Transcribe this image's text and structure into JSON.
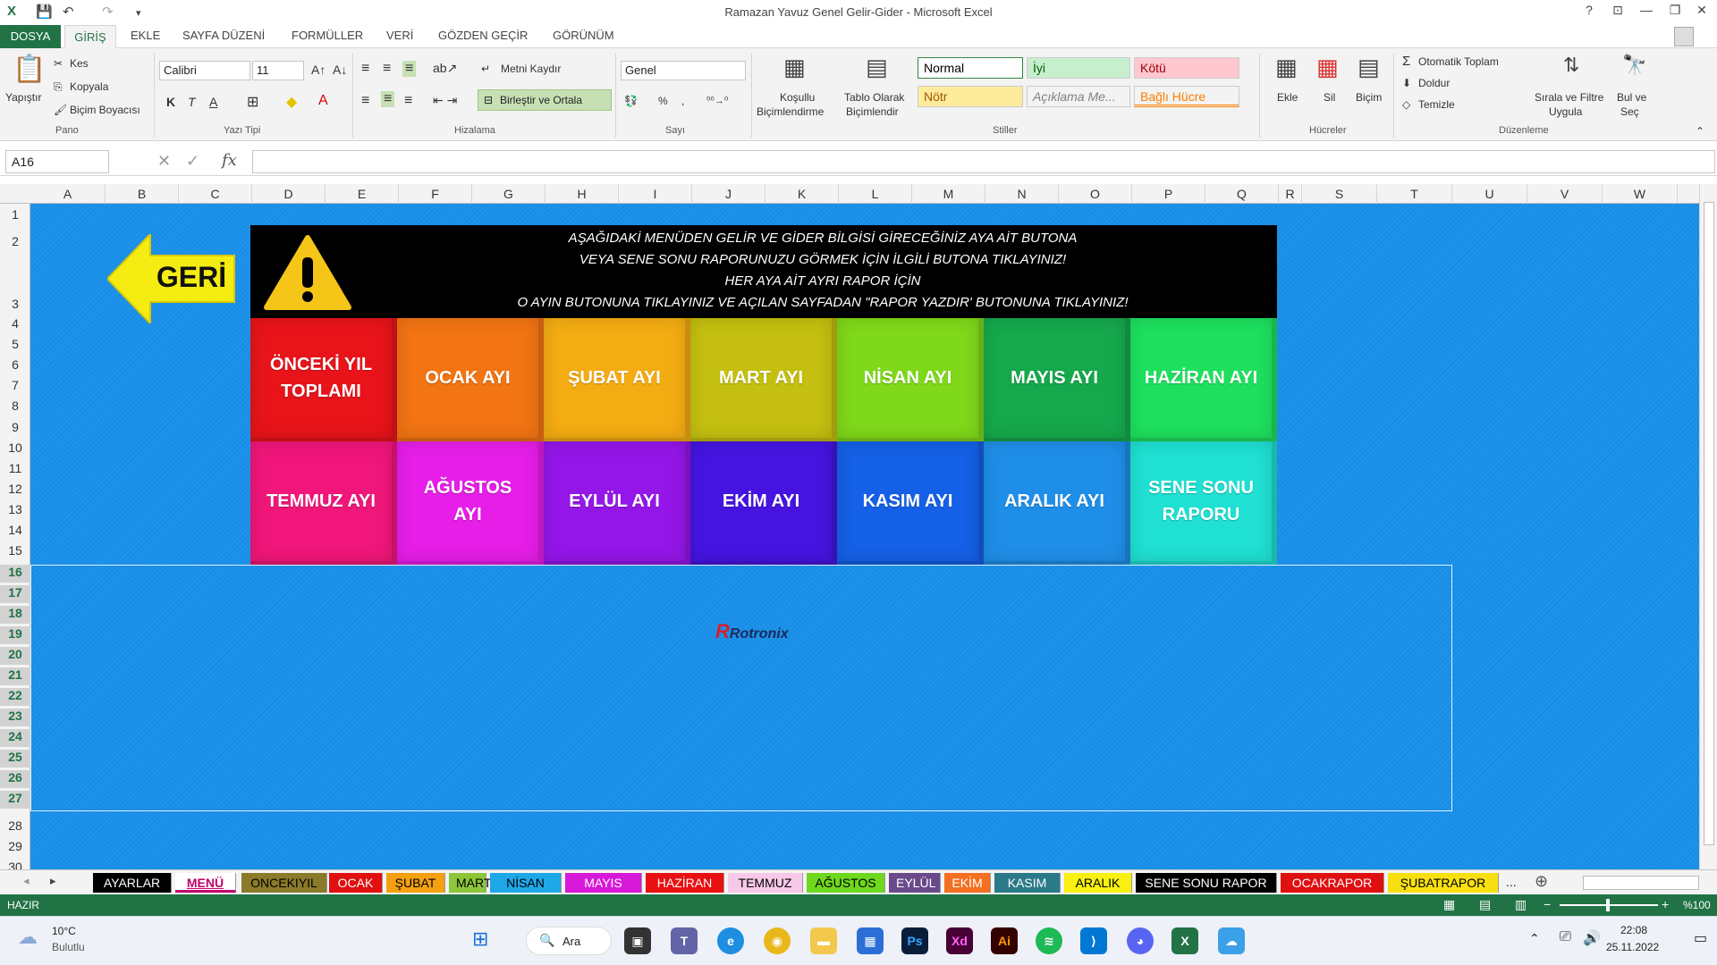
{
  "window": {
    "title": "Ramazan Yavuz Genel Gelir-Gider - Microsoft Excel",
    "help": "?",
    "minimize": "—",
    "restore": "❐",
    "close": "✕"
  },
  "ribbon_tabs": [
    "DOSYA",
    "GİRİŞ",
    "EKLE",
    "SAYFA DÜZENİ",
    "FORMÜLLER",
    "VERİ",
    "GÖZDEN GEÇİR",
    "GÖRÜNÜM"
  ],
  "clipboard": {
    "paste": "Yapıştır",
    "cut": "Kes",
    "copy": "Kopyala",
    "format_painter": "Biçim Boyacısı",
    "group": "Pano"
  },
  "font": {
    "name": "Calibri",
    "size": "11",
    "bold": "K",
    "italic": "T",
    "underline": "A",
    "group": "Yazı Tipi"
  },
  "alignment": {
    "wrap": "Metni Kaydır",
    "merge": "Birleştir ve Ortala",
    "group": "Hizalama"
  },
  "number": {
    "format": "Genel",
    "percent": "%",
    "comma": "⁹",
    "group": "Sayı"
  },
  "styles": {
    "conditional": [
      "Koşullu",
      "Biçimlendirme"
    ],
    "as_table": [
      "Tablo Olarak",
      "Biçimlendir"
    ],
    "cells": [
      {
        "label": "Normal",
        "bg": "#ffffff",
        "fg": "#000000"
      },
      {
        "label": "İyi",
        "bg": "#c6efce",
        "fg": "#006100"
      },
      {
        "label": "Kötü",
        "bg": "#ffc7ce",
        "fg": "#9c0006"
      },
      {
        "label": "Nötr",
        "bg": "#ffeb9c",
        "fg": "#9c5700"
      },
      {
        "label": "Açıklama Me...",
        "bg": "#f3f3f3",
        "fg": "#7f7f7f"
      },
      {
        "label": "Bağlı Hücre",
        "bg": "#f3f3f3",
        "fg": "#fa7d00"
      }
    ],
    "group": "Stiller"
  },
  "cells_group": {
    "insert": "Ekle",
    "delete": "Sil",
    "format": "Biçim",
    "group": "Hücreler"
  },
  "editing": {
    "autosum": "Otomatik Toplam",
    "fill": "Doldur",
    "clear": "Temizle",
    "sort": [
      "Sırala ve Filtre",
      "Uygula"
    ],
    "find": [
      "Bul ve",
      "Seç"
    ],
    "group": "Düzenleme"
  },
  "formula_bar": {
    "name_box": "A16",
    "fx": "fx",
    "value": ""
  },
  "columns": [
    "A",
    "B",
    "C",
    "D",
    "E",
    "F",
    "G",
    "H",
    "I",
    "J",
    "K",
    "L",
    "M",
    "N",
    "O",
    "P",
    "Q",
    "R",
    "S",
    "T",
    "U",
    "V",
    "W"
  ],
  "rows": [
    "1",
    "2",
    "3",
    "4",
    "5",
    "6",
    "7",
    "8",
    "9",
    "10",
    "11",
    "12",
    "13",
    "14",
    "15",
    "16",
    "17",
    "18",
    "19",
    "20",
    "21",
    "22",
    "23",
    "24",
    "25",
    "26",
    "27",
    "28",
    "29",
    "30"
  ],
  "dashboard": {
    "back_label": "GERİ",
    "banner_lines": [
      "AŞAĞIDAKİ MENÜDEN GELİR VE GİDER BİLGİSİ GİRECEĞİNİZ AYA AİT BUTONA",
      "VEYA SENE SONU RAPORUNUZU GÖRMEK İÇİN İLGİLİ BUTONA TIKLAYINIZ!",
      "HER AYA AİT AYRI RAPOR İÇİN",
      "O AYIN BUTONUNA TIKLAYINIZ VE AÇILAN SAYFADAN \"RAPOR YAZDIR' BUTONUNA TIKLAYINIZ!"
    ],
    "buttons": [
      {
        "label": "ÖNCEKİ YIL TOPLAMI",
        "color": "#e8141a"
      },
      {
        "label": "OCAK AYI",
        "color": "#f27413"
      },
      {
        "label": "ŞUBAT AYI",
        "color": "#f4ac13"
      },
      {
        "label": "MART AYI",
        "color": "#c4bf10"
      },
      {
        "label": "NİSAN AYI",
        "color": "#7fd81a"
      },
      {
        "label": "MAYIS AYI",
        "color": "#16a84c"
      },
      {
        "label": "HAZİRAN AYI",
        "color": "#1ee05e"
      },
      {
        "label": "TEMMUZ AYI",
        "color": "#f0167a"
      },
      {
        "label": "AĞUSTOS AYI",
        "color": "#e61ee8"
      },
      {
        "label": "EYLÜL AYI",
        "color": "#9416e8"
      },
      {
        "label": "EKİM AYI",
        "color": "#4514e0"
      },
      {
        "label": "KASIM AYI",
        "color": "#1460e6"
      },
      {
        "label": "ARALIK AYI",
        "color": "#1f8ee8"
      },
      {
        "label": "SENE SONU RAPORU",
        "color": "#1fe0d2"
      }
    ],
    "logo": "Rotronix"
  },
  "sheet_tabs": [
    {
      "label": "AYARLAR",
      "bg": "#000000",
      "fg": "#ffffff"
    },
    {
      "label": "MENÜ",
      "bg": "#ffffff",
      "fg": "#c0006b",
      "active": true
    },
    {
      "label": "ONCEKIYIL",
      "bg": "#8a7a2a",
      "fg": "#000000"
    },
    {
      "label": "OCAK",
      "bg": "#e01010",
      "fg": "#ffffff"
    },
    {
      "label": "ŞUBAT",
      "bg": "#f4a010",
      "fg": "#000000"
    },
    {
      "label": "MART",
      "bg": "#8cc63a",
      "fg": "#000000"
    },
    {
      "label": "NİSAN",
      "bg": "#1fa8e8",
      "fg": "#000000"
    },
    {
      "label": "MAYIS",
      "bg": "#d818d8",
      "fg": "#ffffff"
    },
    {
      "label": "HAZİRAN",
      "bg": "#e81010",
      "fg": "#ffffff"
    },
    {
      "label": "TEMMUZ",
      "bg": "#f8c8e8",
      "fg": "#000000"
    },
    {
      "label": "AĞUSTOS",
      "bg": "#6ed81e",
      "fg": "#000000"
    },
    {
      "label": "EYLÜL",
      "bg": "#6a4a8a",
      "fg": "#ffffff"
    },
    {
      "label": "EKİM",
      "bg": "#f47020",
      "fg": "#ffffff"
    },
    {
      "label": "KASIM",
      "bg": "#2a7a8a",
      "fg": "#ffffff"
    },
    {
      "label": "ARALIK",
      "bg": "#f8f010",
      "fg": "#000000"
    },
    {
      "label": "SENE SONU RAPOR",
      "bg": "#000000",
      "fg": "#ffffff"
    },
    {
      "label": "OCAKRAPOR",
      "bg": "#e01010",
      "fg": "#ffffff"
    },
    {
      "label": "ŞUBATRAPOR",
      "bg": "#f8e010",
      "fg": "#000000"
    }
  ],
  "sheet_more": "...",
  "status": {
    "mode": "HAZIR",
    "zoom": "%100"
  },
  "taskbar": {
    "weather_temp": "10°C",
    "weather_desc": "Bulutlu",
    "search": "Ara",
    "time": "22:08",
    "date": "25.11.2022"
  }
}
